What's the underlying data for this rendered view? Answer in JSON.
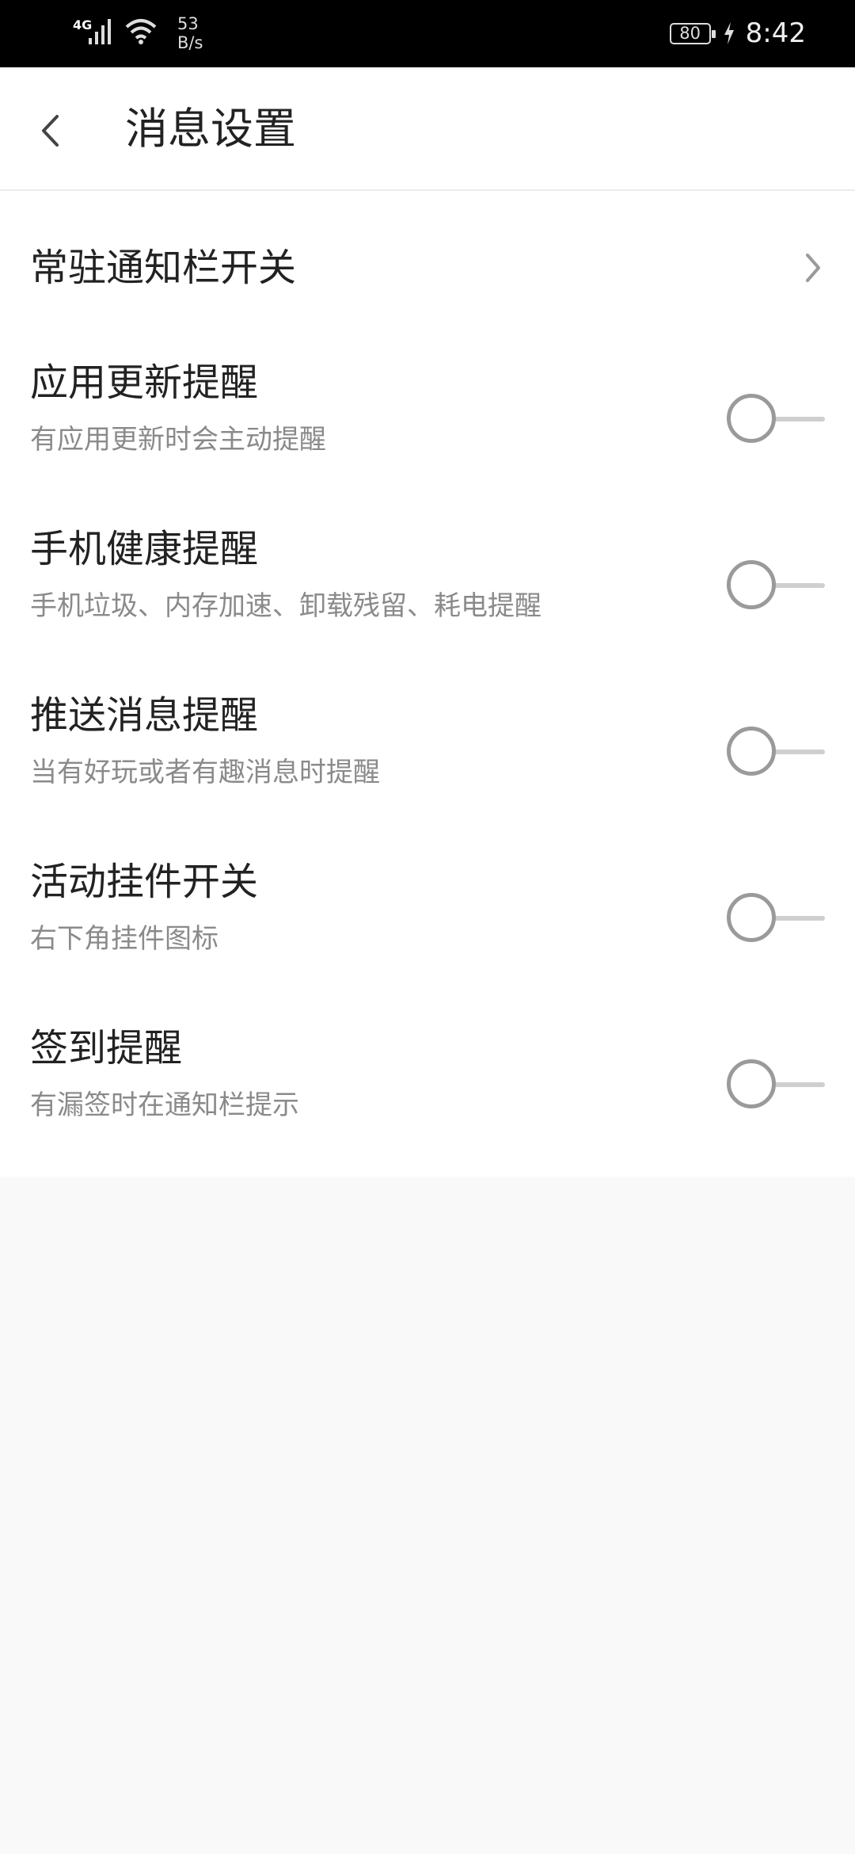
{
  "status_bar": {
    "network": "4G",
    "speed_value": "53",
    "speed_unit": "B/s",
    "battery": "80",
    "time": "8:42"
  },
  "header": {
    "title": "消息设置",
    "back_icon": "back-arrow-icon"
  },
  "settings": {
    "persistent_notification": {
      "label": "常驻通知栏开关",
      "icon": "chevron-right-icon"
    },
    "items": [
      {
        "label": "应用更新提醒",
        "desc": "有应用更新时会主动提醒",
        "enabled": false
      },
      {
        "label": "手机健康提醒",
        "desc": "手机垃圾、内存加速、卸载残留、耗电提醒",
        "enabled": false
      },
      {
        "label": "推送消息提醒",
        "desc": "当有好玩或者有趣消息时提醒",
        "enabled": false
      },
      {
        "label": "活动挂件开关",
        "desc": "右下角挂件图标",
        "enabled": false
      },
      {
        "label": "签到提醒",
        "desc": "有漏签时在通知栏提示",
        "enabled": false
      }
    ]
  },
  "colors": {
    "status_bar_bg": "#000000",
    "page_bg": "#f9f9f9",
    "list_bg": "#ffffff",
    "toggle_off": "#9a9a9a"
  }
}
